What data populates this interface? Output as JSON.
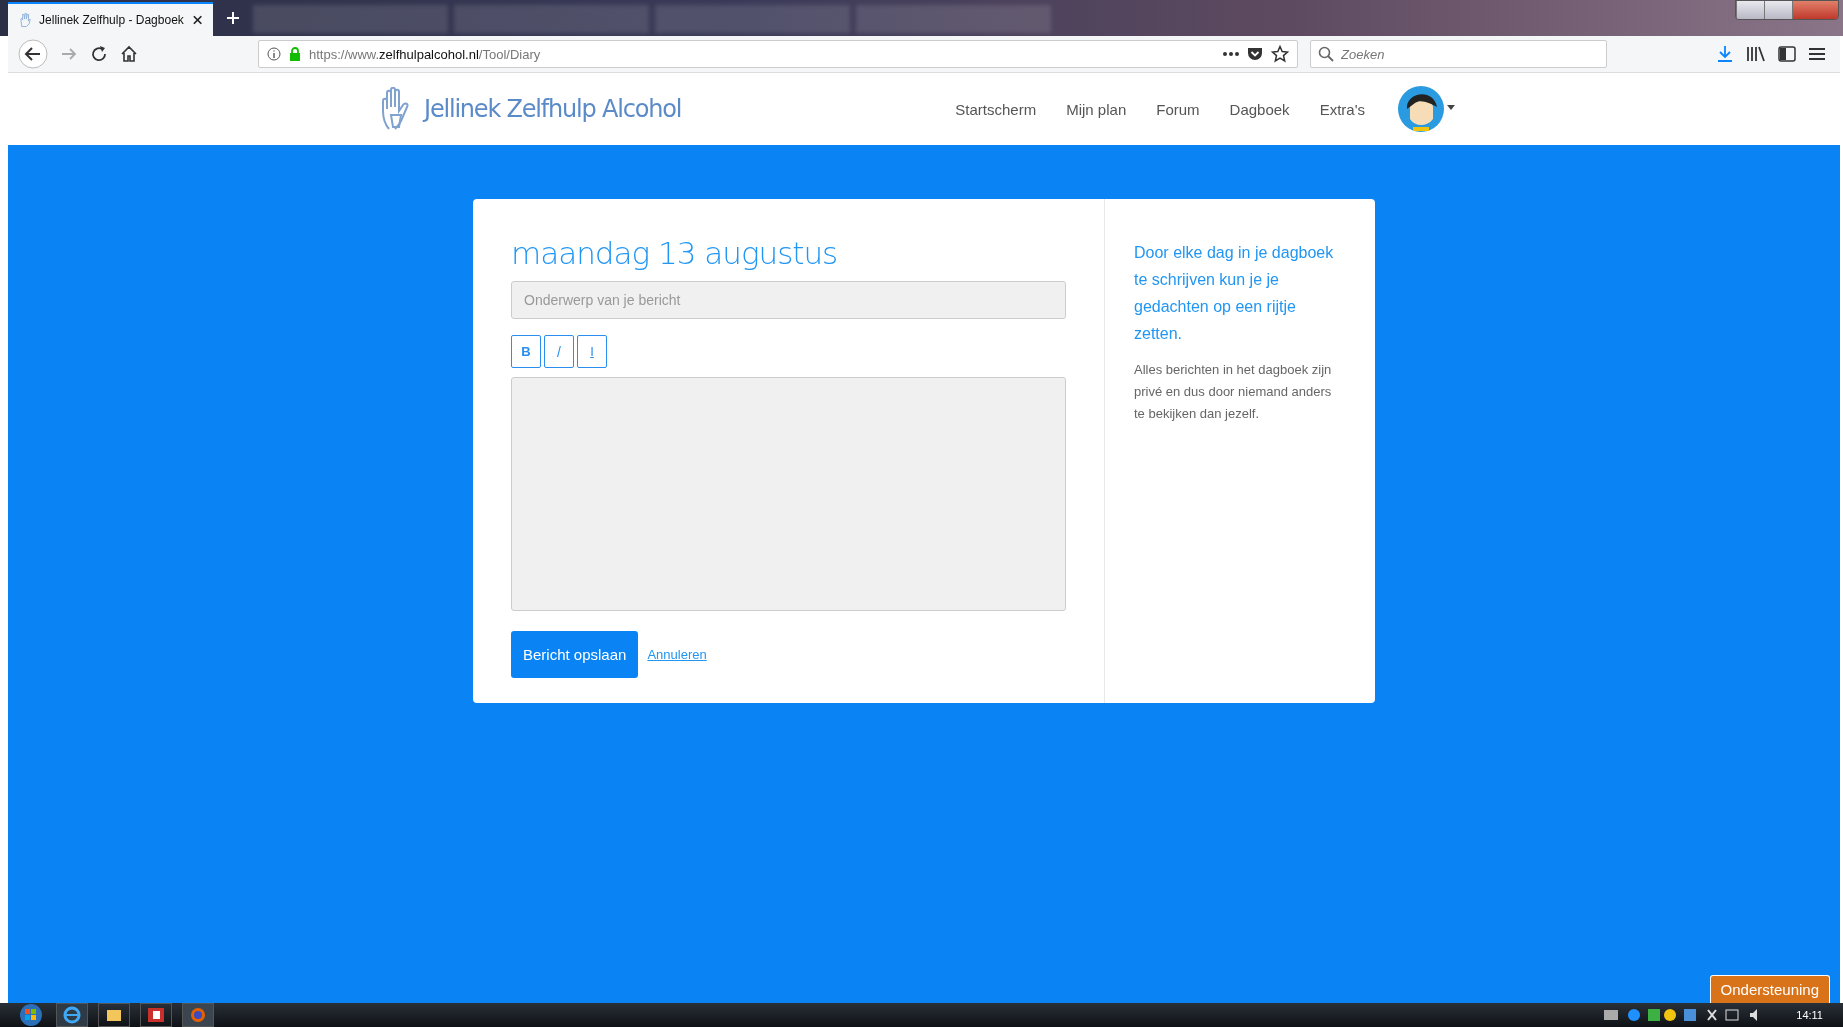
{
  "browser": {
    "tabs": [
      {
        "kind": "page",
        "title": "Jellinek Zelfhulp - Dagboek",
        "selected": true
      },
      {
        "kind": "new"
      },
      {
        "kind": "blurred",
        "selected": false
      },
      {
        "kind": "blurred",
        "selected": false
      },
      {
        "kind": "blurred",
        "selected": false
      },
      {
        "kind": "blurred",
        "selected": false
      }
    ],
    "url": {
      "host": "https://www.",
      "domain": "zelfhulpalcohol.nl",
      "path": "/Tool/Diary"
    },
    "search": {
      "placeholder": "Zoeken"
    }
  },
  "site": {
    "logo": "Jellinek Zelfhulp Alcohol",
    "nav": [
      {
        "label": "Startscherm"
      },
      {
        "label": "Mijn plan"
      },
      {
        "label": "Forum"
      },
      {
        "label": "Dagboek"
      },
      {
        "label": "Extra's"
      }
    ]
  },
  "editor": {
    "title": "maandag 13 augustus",
    "subject": {
      "placeholder": "Onderwerp van je bericht"
    },
    "format_buttons": [
      {
        "kind": "bold",
        "label": "B"
      },
      {
        "kind": "italic",
        "label": "/"
      },
      {
        "kind": "underline",
        "label": "I"
      }
    ],
    "save": "Bericht opslaan",
    "cancel": "Annuleren"
  },
  "aside": {
    "lead": "Door elke dag in je dagboek te schrijven kun je je gedachten op een rijtje zetten.",
    "note": "Alles berichten in het dagboek zijn privé en dus door niemand anders te bekijken dan jezelf."
  },
  "support": "Ondersteuning",
  "taskbar": {
    "clock": "14:11"
  }
}
